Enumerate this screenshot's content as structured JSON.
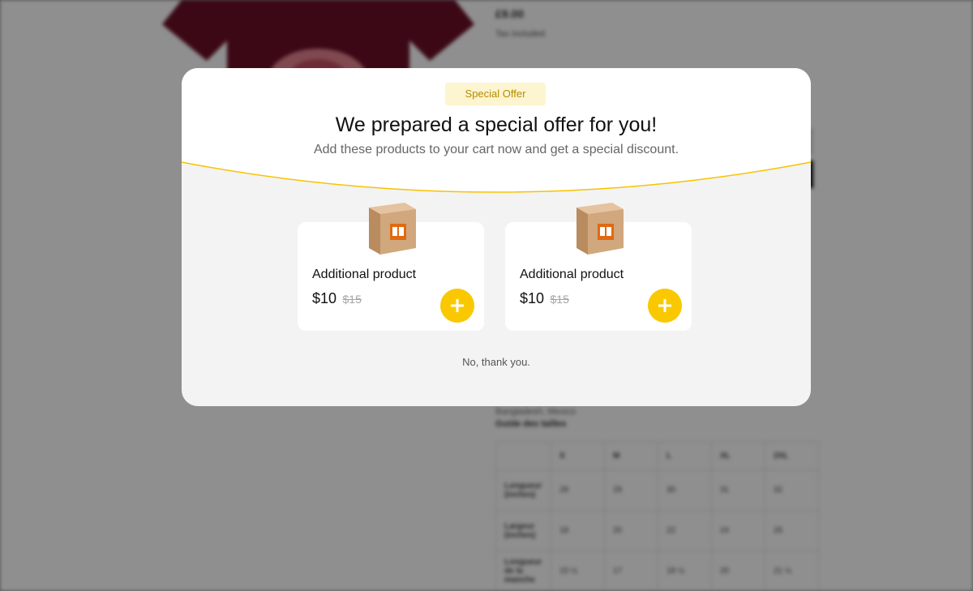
{
  "background_page": {
    "price": "£9.00",
    "tax_note": "Tax included",
    "countries_text": "Bangladesh, Mexico",
    "size_guide_title": "Guide des tailles",
    "size_table": {
      "headers": [
        "",
        "S",
        "M",
        "L",
        "XL",
        "2XL"
      ],
      "rows": [
        {
          "label": "Longueur (inches)",
          "values": [
            "28",
            "29",
            "30",
            "31",
            "32"
          ]
        },
        {
          "label": "Largeur (inches)",
          "values": [
            "18",
            "20",
            "22",
            "24",
            "26"
          ]
        },
        {
          "label": "Longueur de la manche",
          "values": [
            "15 ½",
            "17",
            "18 ½",
            "20",
            "21 ½"
          ]
        }
      ]
    }
  },
  "modal": {
    "badge": "Special Offer",
    "title": "We prepared a special offer for you!",
    "subtitle": "Add these products to your cart now and get a special discount.",
    "products": [
      {
        "name": "Additional product",
        "price": "$10",
        "old_price": "$15",
        "icon": "box-icon"
      },
      {
        "name": "Additional product",
        "price": "$10",
        "old_price": "$15",
        "icon": "box-icon"
      }
    ],
    "decline": "No, thank you."
  },
  "colors": {
    "accent": "#fac800",
    "badge_bg": "#fdf5cf",
    "badge_text": "#b58c00",
    "curve": "#f7c300",
    "overlay": "rgba(0,0,0,0.44)",
    "tshirt": "#6b0f27"
  }
}
